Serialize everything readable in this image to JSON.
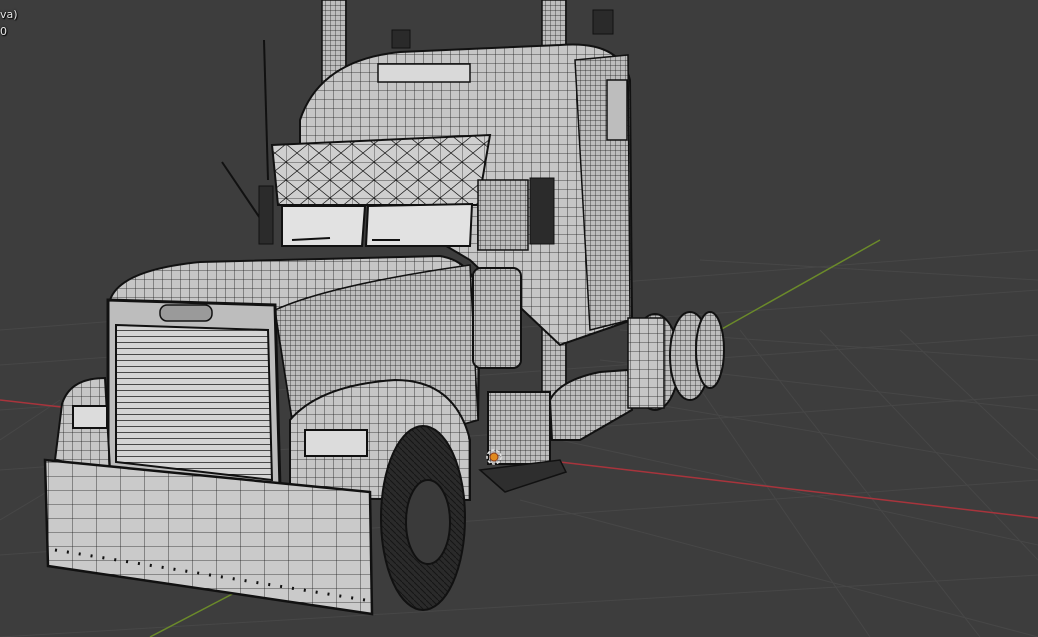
{
  "viewport": {
    "overlay_line1": "va)",
    "overlay_line2": "0",
    "background_color": "#3d3d3d",
    "grid_color": "#474747",
    "x_axis_color": "#a8343c",
    "y_axis_color": "#6b8a2a",
    "wire_color": "#1a1a1a",
    "mesh_face_color": "#c8c8c8"
  },
  "scene": {
    "object": "semi-truck-tractor",
    "shading_mode": "wireframe-over-solid",
    "origin_marker_color": "#e08a1e"
  }
}
